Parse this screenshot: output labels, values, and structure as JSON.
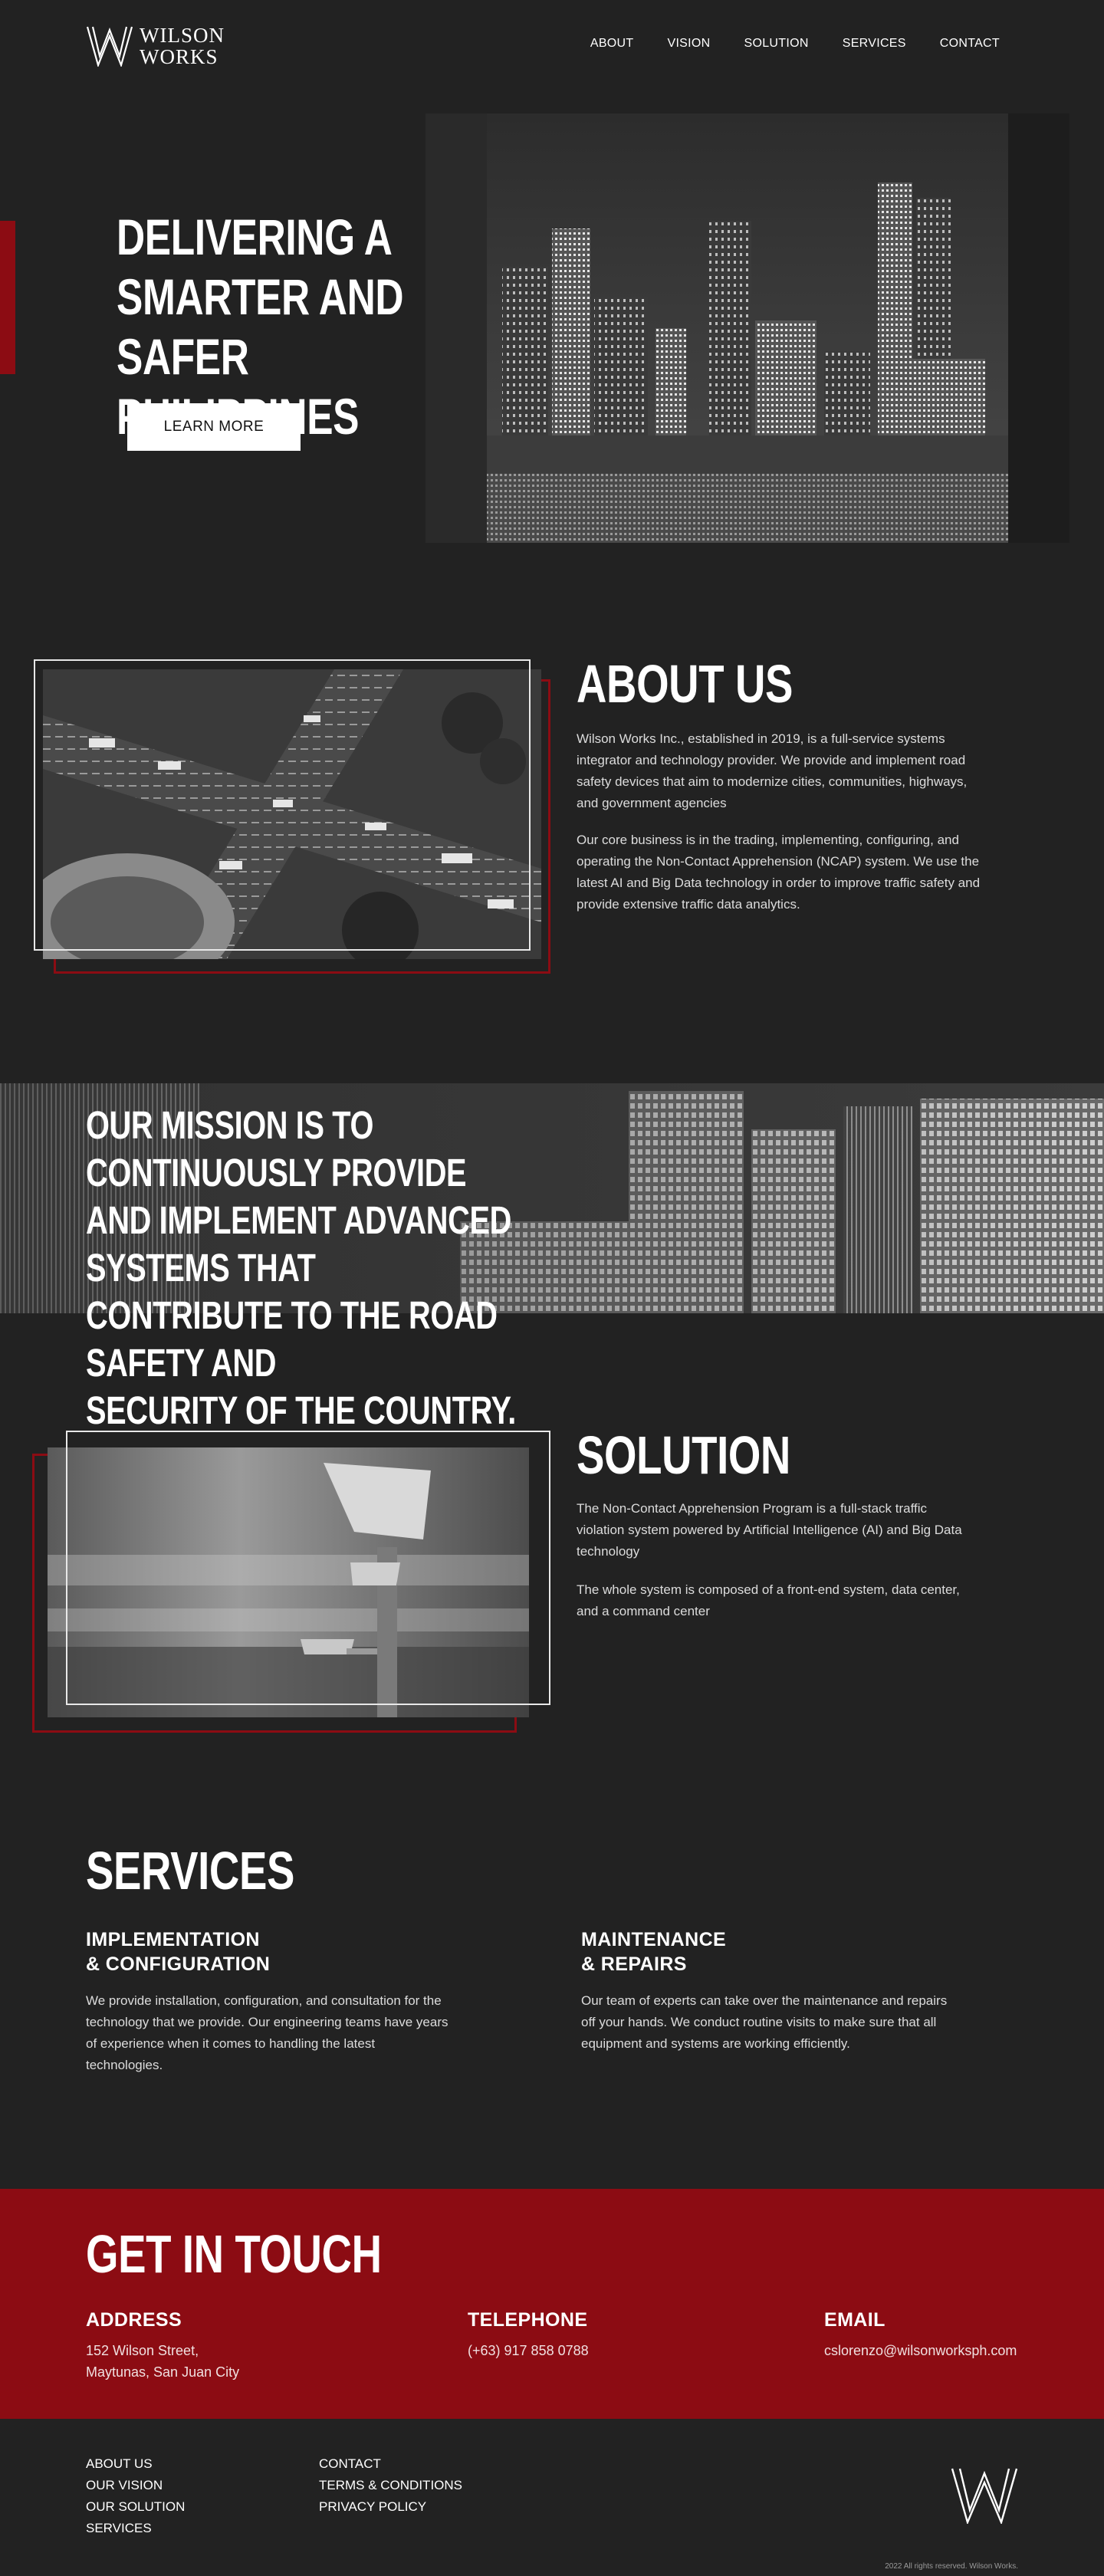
{
  "brand": {
    "logo_mark": "w-logo-icon",
    "line1": "WILSON",
    "line2": "WORKS"
  },
  "nav": {
    "items": [
      "ABOUT",
      "VISION",
      "SOLUTION",
      "SERVICES",
      "CONTACT"
    ]
  },
  "hero": {
    "title_lines": [
      "DELIVERING A",
      "SMARTER AND",
      "SAFER PHILIPPINES"
    ],
    "button": "LEARN MORE"
  },
  "about": {
    "heading": "ABOUT US",
    "p1": "Wilson Works Inc., established in 2019, is a full-service systems integrator and technology provider. We provide and implement road safety devices that aim to modernize cities, communities, highways, and government agencies",
    "p2": "Our core business is in the trading, implementing, configuring, and operating the Non-Contact Apprehension (NCAP) system. We use the latest AI and Big Data technology in order to improve traffic safety and provide extensive traffic data analytics."
  },
  "mission": {
    "lines": [
      "OUR MISSION IS TO CONTINUOUSLY PROVIDE",
      "AND IMPLEMENT ADVANCED SYSTEMS THAT",
      "CONTRIBUTE TO THE ROAD SAFETY AND",
      "SECURITY OF THE COUNTRY."
    ]
  },
  "solution": {
    "heading": "SOLUTION",
    "p1": "The Non-Contact Apprehension Program is a full-stack traffic violation system powered by Artificial Intelligence (AI) and Big Data technology",
    "p2": "The whole system is composed of a front-end system, data center, and a command center"
  },
  "services": {
    "heading": "SERVICES",
    "items": [
      {
        "title1": "IMPLEMENTATION",
        "title2": "& CONFIGURATION",
        "text": "We provide installation, configuration, and consultation for the technology that we provide. Our engineering teams have years of experience when it comes to handling the latest technologies."
      },
      {
        "title1": "MAINTENANCE",
        "title2": "& REPAIRS",
        "text": "Our team of experts can take over the maintenance and repairs off your hands. We conduct routine visits to make sure that all equipment and systems are working efficiently."
      }
    ]
  },
  "contact": {
    "heading": "GET IN TOUCH",
    "address_label": "ADDRESS",
    "address_line1": "152 Wilson Street,",
    "address_line2": "Maytunas, San Juan City",
    "phone_label": "TELEPHONE",
    "phone": "(+63) 917 858 0788",
    "email_label": "EMAIL",
    "email": "cslorenzo@wilsonworksph.com"
  },
  "footer": {
    "col1": [
      "ABOUT US",
      "OUR VISION",
      "OUR SOLUTION",
      "SERVICES"
    ],
    "col2": [
      "CONTACT",
      "TERMS & CONDITIONS",
      "PRIVACY POLICY"
    ],
    "copyright": "2022 All rights reserved. Wilson Works."
  },
  "colors": {
    "background": "#222222",
    "accent_red": "#8c0c13",
    "text": "#ffffff"
  }
}
